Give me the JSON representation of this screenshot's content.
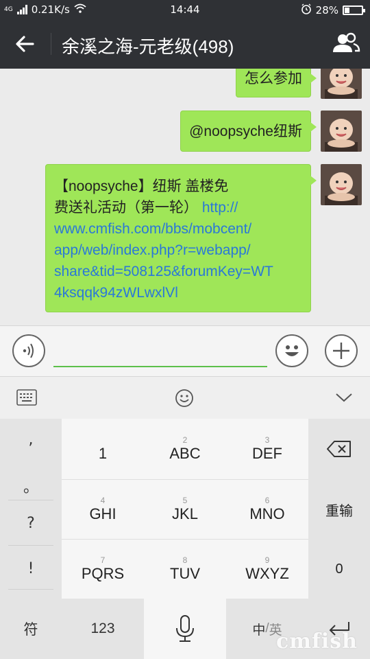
{
  "status_bar": {
    "network_label": "4G",
    "speed": "0.21K/s",
    "time": "14:44",
    "battery_percent": "28%",
    "battery_level": 0.28
  },
  "header": {
    "title": "余溪之海-元老级(498)",
    "back_icon": "arrow-left-icon",
    "group_icon": "group-members-icon"
  },
  "messages": [
    {
      "text": "怎么参加"
    },
    {
      "text": "@noopsyche纽斯"
    },
    {
      "lines": [
        "【noopsyche】纽斯 盖楼免",
        "费送礼活动（第一轮）"
      ],
      "link_inline": "http://",
      "link_lines": [
        "www.cmfish.com/bbs/mobcent/",
        "app/web/index.php?r=webapp/",
        "share&tid=508125&forumKey=WT",
        "4ksqqk94zWLwxlVl"
      ]
    }
  ],
  "input": {
    "value": "",
    "placeholder": ""
  },
  "keyboard": {
    "keys": [
      {
        "num": "",
        "label": "1"
      },
      {
        "num": "2",
        "label": "ABC"
      },
      {
        "num": "3",
        "label": "DEF"
      },
      {
        "num": "4",
        "label": "GHI"
      },
      {
        "num": "5",
        "label": "JKL"
      },
      {
        "num": "6",
        "label": "MNO"
      },
      {
        "num": "7",
        "label": "PQRS"
      },
      {
        "num": "8",
        "label": "TUV"
      },
      {
        "num": "9",
        "label": "WXYZ"
      }
    ],
    "punct": [
      ",",
      "。",
      "?",
      "!"
    ],
    "reinput": "重输",
    "zero": "0",
    "symbols": "符",
    "numbers": "123",
    "lang_zh": "中",
    "lang_sep": "/",
    "lang_en": "英"
  },
  "watermark": "cmfish"
}
